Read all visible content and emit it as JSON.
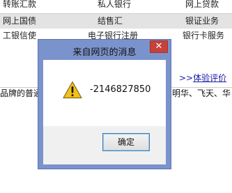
{
  "background": {
    "rows": [
      [
        "转账汇款",
        "私人银行",
        "网上贷款"
      ],
      [
        "网上国债",
        "结售汇",
        "银证业务"
      ],
      [
        "工银信使",
        "电子银行注册",
        "银行卡服务"
      ]
    ],
    "link_arrows": ">>",
    "link_label": "体验评价",
    "body_left": "品牌的普通",
    "body_right": "明华、飞天、华"
  },
  "dialog": {
    "title": "来自网页的消息",
    "close_symbol": "✕",
    "icon": "warning-icon",
    "message": "-2146827850",
    "ok_label": "确定"
  },
  "colors": {
    "frame": "#7b93cc",
    "close": "#c7423a",
    "footer": "#f0f0f0",
    "link": "#1a1aa6"
  }
}
